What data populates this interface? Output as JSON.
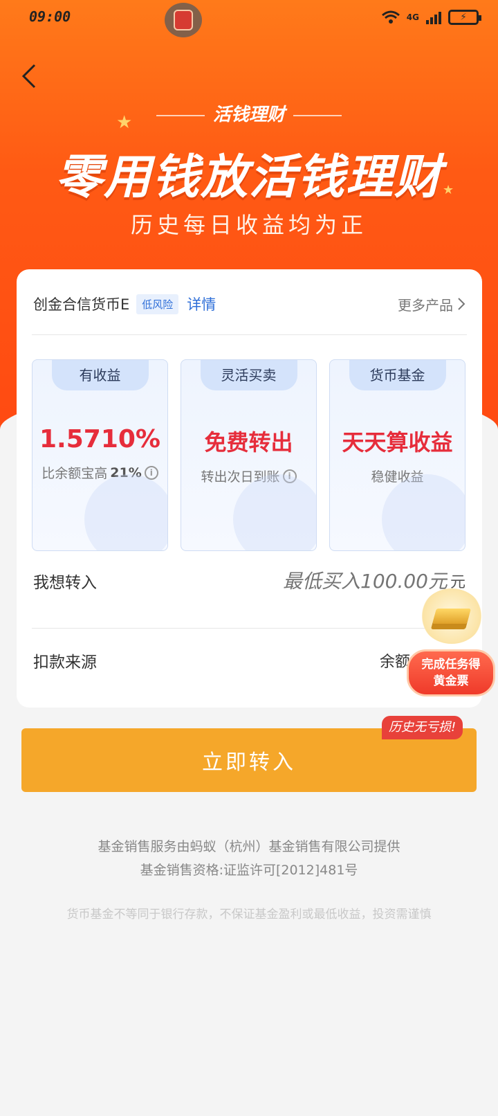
{
  "status_bar": {
    "time": "09:00",
    "network": "4G"
  },
  "hero": {
    "tag": "活钱理财",
    "title": "零用钱放活钱理财",
    "subtitle": "历史每日收益均为正"
  },
  "fund": {
    "name": "创金合信货币E",
    "risk": "低风险",
    "detail": "详情",
    "more": "更多产品"
  },
  "features": [
    {
      "tab": "有收益",
      "big": "1.5710%",
      "small_prefix": "比余额宝高",
      "small_bold": "21%",
      "has_info": true
    },
    {
      "tab": "灵活买卖",
      "big": "免费转出",
      "small_prefix": "转出次日到账",
      "small_bold": "",
      "has_info": true
    },
    {
      "tab": "货币基金",
      "big": "天天算收益",
      "small_prefix": "稳健收益",
      "small_bold": "",
      "has_info": false
    }
  ],
  "form": {
    "amount_label": "我想转入",
    "amount_placeholder": "最低买入100.00元",
    "amount_unit": "元",
    "source_label": "扣款来源",
    "source_value": "余额"
  },
  "promo": {
    "line1": "完成任务得",
    "line2": "黄金票"
  },
  "history_badge": "历史无亏损!",
  "submit_label": "立即转入",
  "footer": {
    "line1": "基金销售服务由蚂蚁（杭州）基金销售有限公司提供",
    "line2": "基金销售资格:证监许可[2012]481号",
    "disclaimer": "货币基金不等同于银行存款，不保证基金盈利或最低收益，投资需谨慎"
  },
  "colors": {
    "hero": "#ff5a14",
    "accent_red": "#e62d3b",
    "button": "#f5a72a",
    "link_blue": "#2f6fd8"
  }
}
